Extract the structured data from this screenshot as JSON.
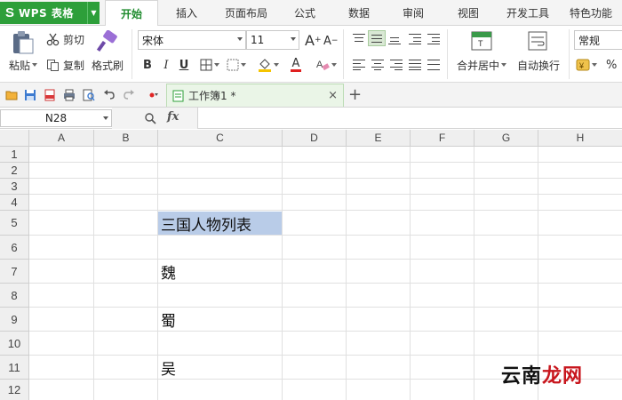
{
  "app": {
    "name": "WPS 表格",
    "logo_letter": "S"
  },
  "menu": {
    "tabs": [
      "开始",
      "插入",
      "页面布局",
      "公式",
      "数据",
      "审阅",
      "视图",
      "开发工具",
      "特色功能"
    ],
    "active_index": 0
  },
  "ribbon": {
    "paste_label": "粘贴",
    "cut_label": "剪切",
    "copy_label": "复制",
    "format_painter_label": "格式刷",
    "font_name": "宋体",
    "font_size": "11",
    "merge_center_label": "合并居中",
    "wrap_text_label": "自动换行",
    "number_format": "常规",
    "bold": "B",
    "italic": "I",
    "underline": "U",
    "font_color_glyph": "A",
    "percent": "%",
    "grow_font": "A",
    "shrink_font": "A"
  },
  "tabs": {
    "document_title": "工作簿1 *",
    "close_glyph": "×",
    "new_tab_glyph": "+"
  },
  "formula_bar": {
    "name_box": "N28",
    "fx_label": "fx",
    "formula_value": ""
  },
  "sheet": {
    "columns": [
      "A",
      "B",
      "C",
      "D",
      "E",
      "F",
      "G",
      "H"
    ],
    "rows": [
      "1",
      "2",
      "3",
      "4",
      "5",
      "6",
      "7",
      "8",
      "9",
      "10",
      "11",
      "12"
    ],
    "cells": {
      "C5": "三国人物列表",
      "C7": "魏",
      "C9": "蜀",
      "C11": "吴"
    },
    "selection_color": "#b9cce8"
  },
  "watermark": {
    "part1": "云南",
    "part2": "龙网"
  },
  "colors": {
    "brand_green": "#2d9f3a",
    "active_tab_text": "#1f8b2e"
  }
}
